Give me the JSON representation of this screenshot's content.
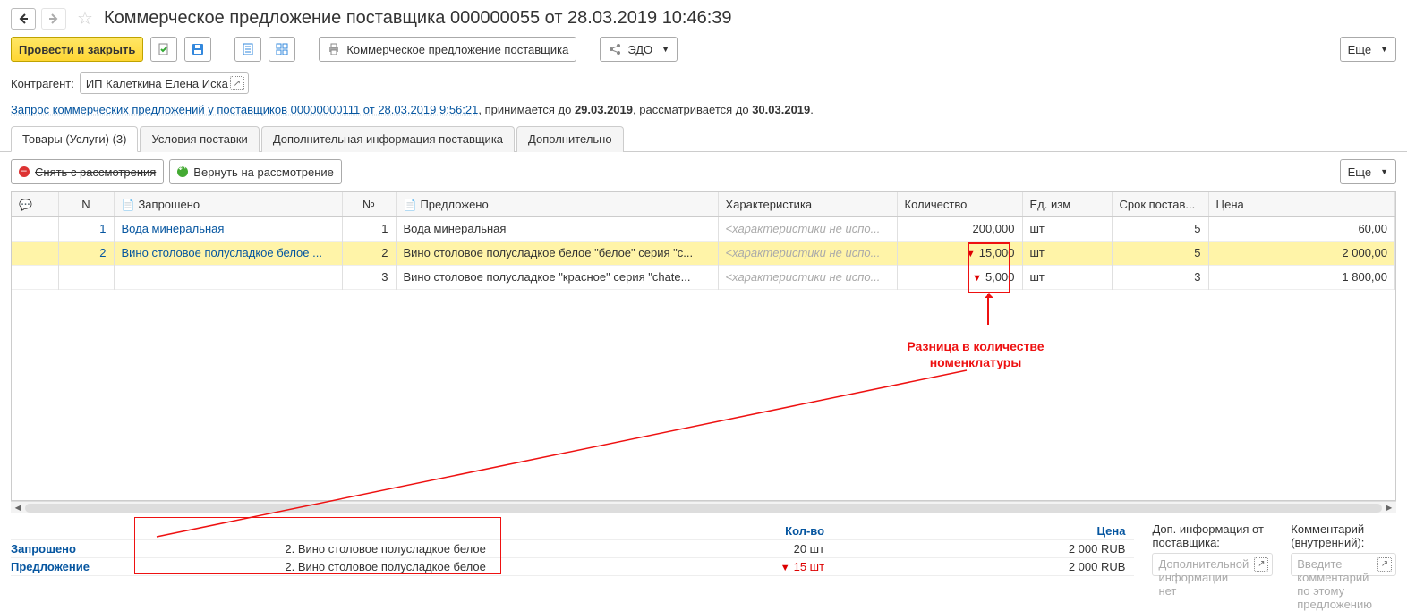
{
  "page_title": "Коммерческое предложение поставщика 000000055 от 28.03.2019 10:46:39",
  "toolbar": {
    "post_close": "Провести и закрыть",
    "print_doc": "Коммерческое предложение поставщика",
    "edo": "ЭДО",
    "more": "Еще"
  },
  "contractor": {
    "label": "Контрагент:",
    "value": "ИП Калеткина Елена Иска"
  },
  "infoline": {
    "link": "Запрос коммерческих предложений у поставщиков 00000000111 от 28.03.2019 9:56:21",
    "text1": ", принимается до ",
    "date1": "29.03.2019",
    "text2": ", рассматривается до ",
    "date2": "30.03.2019"
  },
  "tabs": [
    "Товары (Услуги) (3)",
    "Условия поставки",
    "Дополнительная информация поставщика",
    "Дополнительно"
  ],
  "subtoolbar": {
    "remove": "Снять с рассмотрения",
    "return": "Вернуть на рассмотрение",
    "more": "Еще"
  },
  "columns": {
    "chat": "",
    "n": "N",
    "requested": "Запрошено",
    "num": "№",
    "offered": "Предложено",
    "char": "Характеристика",
    "qty": "Количество",
    "unit": "Ед. изм",
    "term": "Срок постав...",
    "price": "Цена"
  },
  "rows": [
    {
      "n": "1",
      "requested": "Вода минеральная",
      "num": "1",
      "offered": "Вода минеральная",
      "char": "<характеристики не испо...",
      "warn": "",
      "qty": "200,000",
      "unit": "шт",
      "term": "5",
      "price": "60,00",
      "selected": false
    },
    {
      "n": "2",
      "requested": "Вино столовое полусладкое белое ...",
      "num": "2",
      "offered": "Вино столовое полусладкое белое \"белое\" серия \"с...",
      "char": "<характеристики не испо...",
      "warn": "▼",
      "qty": "15,000",
      "unit": "шт",
      "term": "5",
      "price": "2 000,00",
      "selected": true
    },
    {
      "n": "",
      "requested": "",
      "num": "3",
      "offered": "Вино столовое полусладкое \"красное\" серия \"chate...",
      "char": "<характеристики не испо...",
      "warn": "▼",
      "qty": "5,000",
      "unit": "шт",
      "term": "3",
      "price": "1 800,00",
      "selected": false
    }
  ],
  "annotation": {
    "text1": "Разница в количестве",
    "text2": "номенклатуры"
  },
  "summary": {
    "col_qty": "Кол-во",
    "col_price": "Цена",
    "requested_lbl": "Запрошено",
    "offer_lbl": "Предложение",
    "req_name": "2. Вино столовое полусладкое белое",
    "req_qty": "20 шт",
    "req_price": "2 000 RUB",
    "off_name": "2. Вино столовое полусладкое белое",
    "off_qty": "15 шт",
    "off_price": "2 000 RUB"
  },
  "side": {
    "info_label": "Доп. информация от поставщика:",
    "info_placeholder": "Дополнительной информации нет",
    "comment_label": "Комментарий (внутренний):",
    "comment_placeholder": "Введите комментарий по этому предложению"
  }
}
